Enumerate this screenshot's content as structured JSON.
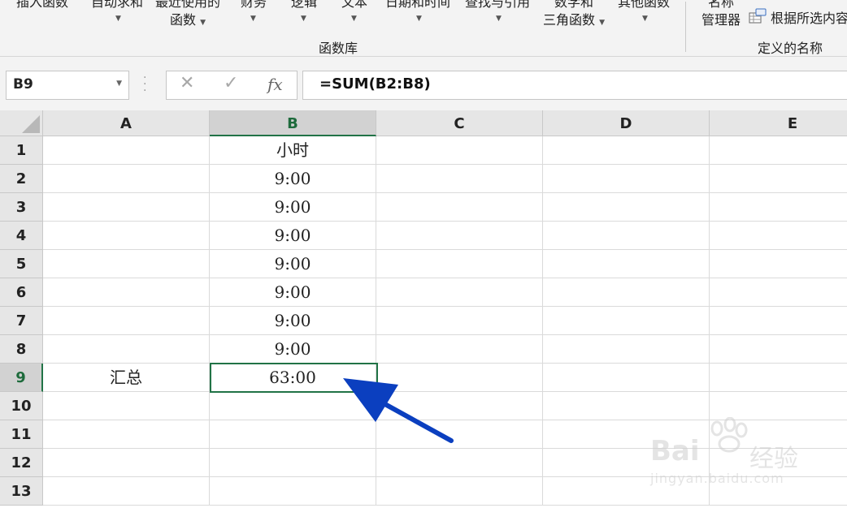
{
  "ribbon": {
    "buttons": [
      {
        "id": "insert-function",
        "line1": "插入函数",
        "line2": ""
      },
      {
        "id": "autosum",
        "line1": "自动求和",
        "line2": ""
      },
      {
        "id": "recently-used",
        "line1": "最近使用的",
        "line2": "函数"
      },
      {
        "id": "financial",
        "line1": "财务",
        "line2": ""
      },
      {
        "id": "logical",
        "line1": "逻辑",
        "line2": ""
      },
      {
        "id": "text",
        "line1": "文本",
        "line2": ""
      },
      {
        "id": "date-time",
        "line1": "日期和时间",
        "line2": ""
      },
      {
        "id": "lookup-reference",
        "line1": "查找与引用",
        "line2": ""
      },
      {
        "id": "math-trig",
        "line1": "数学和",
        "line2": "三角函数"
      },
      {
        "id": "more-functions",
        "line1": "其他函数",
        "line2": ""
      },
      {
        "id": "name-manager",
        "line1": "名称",
        "line2": "管理器"
      }
    ],
    "create_from_selection": "根据所选内容创建",
    "group_function_library": "函数库",
    "group_defined_names": "定义的名称",
    "icons": {
      "create_from_selection": "create-from-selection-icon"
    }
  },
  "formula_bar": {
    "name_box": "B9",
    "cancel_icon": "✕",
    "enter_icon": "✓",
    "fx_label": "fx",
    "formula": "=SUM(B2:B8)"
  },
  "sheet": {
    "columns": [
      "A",
      "B",
      "C",
      "D",
      "E"
    ],
    "rows": [
      "1",
      "2",
      "3",
      "4",
      "5",
      "6",
      "7",
      "8",
      "9",
      "10",
      "11",
      "12",
      "13"
    ],
    "selected_column": "B",
    "selected_row": "9",
    "cells": [
      [
        "",
        "小时",
        "",
        "",
        ""
      ],
      [
        "",
        "9:00",
        "",
        "",
        ""
      ],
      [
        "",
        "9:00",
        "",
        "",
        ""
      ],
      [
        "",
        "9:00",
        "",
        "",
        ""
      ],
      [
        "",
        "9:00",
        "",
        "",
        ""
      ],
      [
        "",
        "9:00",
        "",
        "",
        ""
      ],
      [
        "",
        "9:00",
        "",
        "",
        ""
      ],
      [
        "",
        "9:00",
        "",
        "",
        ""
      ],
      [
        "汇总",
        "63:00",
        "",
        "",
        ""
      ],
      [
        "",
        "",
        "",
        "",
        ""
      ],
      [
        "",
        "",
        "",
        "",
        ""
      ],
      [
        "",
        "",
        "",
        "",
        ""
      ],
      [
        "",
        "",
        "",
        "",
        ""
      ]
    ]
  },
  "colors": {
    "accent_green": "#217346",
    "arrow_blue": "#0b3fbf"
  },
  "watermark": {
    "logo": "Bai",
    "logo_cn": "经验",
    "url": "jingyan.baidu.com"
  }
}
